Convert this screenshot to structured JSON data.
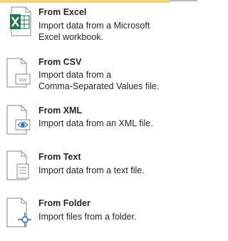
{
  "menu": {
    "items": [
      {
        "id": "excel",
        "icon": "excel-file-icon",
        "title": "From Excel",
        "desc_lines": [
          "Import data from a Microsoft",
          "Excel workbook."
        ]
      },
      {
        "id": "csv",
        "icon": "csv-file-icon",
        "title": "From CSV",
        "desc_lines": [
          "Import data from a",
          "Comma-Separated Values file."
        ]
      },
      {
        "id": "xml",
        "icon": "xml-file-icon",
        "title": "From XML",
        "desc_lines": [
          "Import data from an XML file."
        ]
      },
      {
        "id": "text",
        "icon": "text-file-icon",
        "title": "From Text",
        "desc_lines": [
          "Import data from a text file."
        ]
      },
      {
        "id": "folder",
        "icon": "folder-network-icon",
        "title": "From Folder",
        "desc_lines": [
          "Import files from a folder."
        ]
      }
    ]
  },
  "colors": {
    "highlight": "#fce4a8",
    "excel_green": "#1d7a45",
    "folder_blue": "#2f6db5"
  }
}
